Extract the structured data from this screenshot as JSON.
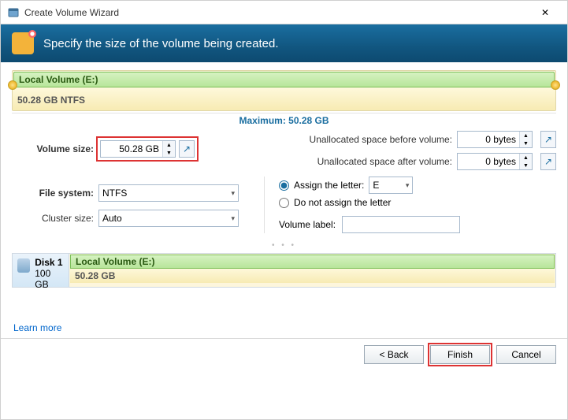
{
  "window": {
    "title": "Create Volume Wizard",
    "close_icon": "✕"
  },
  "header": {
    "text": "Specify the size of the volume being created."
  },
  "volume_bar": {
    "name": "Local Volume (E:)",
    "desc": "50.28 GB NTFS"
  },
  "maximum_label": "Maximum: 50.28 GB",
  "volume_size": {
    "label": "Volume size:",
    "value": "50.28 GB"
  },
  "unalloc_before": {
    "label": "Unallocated space before volume:",
    "value": "0 bytes"
  },
  "unalloc_after": {
    "label": "Unallocated space after volume:",
    "value": "0 bytes"
  },
  "filesystem": {
    "label": "File system:",
    "value": "NTFS"
  },
  "cluster": {
    "label": "Cluster size:",
    "value": "Auto"
  },
  "assign_letter": {
    "label": "Assign the letter:",
    "value": "E",
    "checked": true
  },
  "no_assign": {
    "label": "Do not assign the letter",
    "checked": false
  },
  "volume_label": {
    "label": "Volume label:",
    "value": ""
  },
  "disk_panel": {
    "disk_name": "Disk 1",
    "disk_size": "100 GB",
    "vol_name": "Local Volume (E:)",
    "vol_size": "50.28 GB"
  },
  "learn_more": "Learn more",
  "buttons": {
    "back": "< Back",
    "finish": "Finish",
    "cancel": "Cancel"
  },
  "icons": {
    "expand": "↗",
    "caret": "▾",
    "up": "▲",
    "down": "▼"
  }
}
